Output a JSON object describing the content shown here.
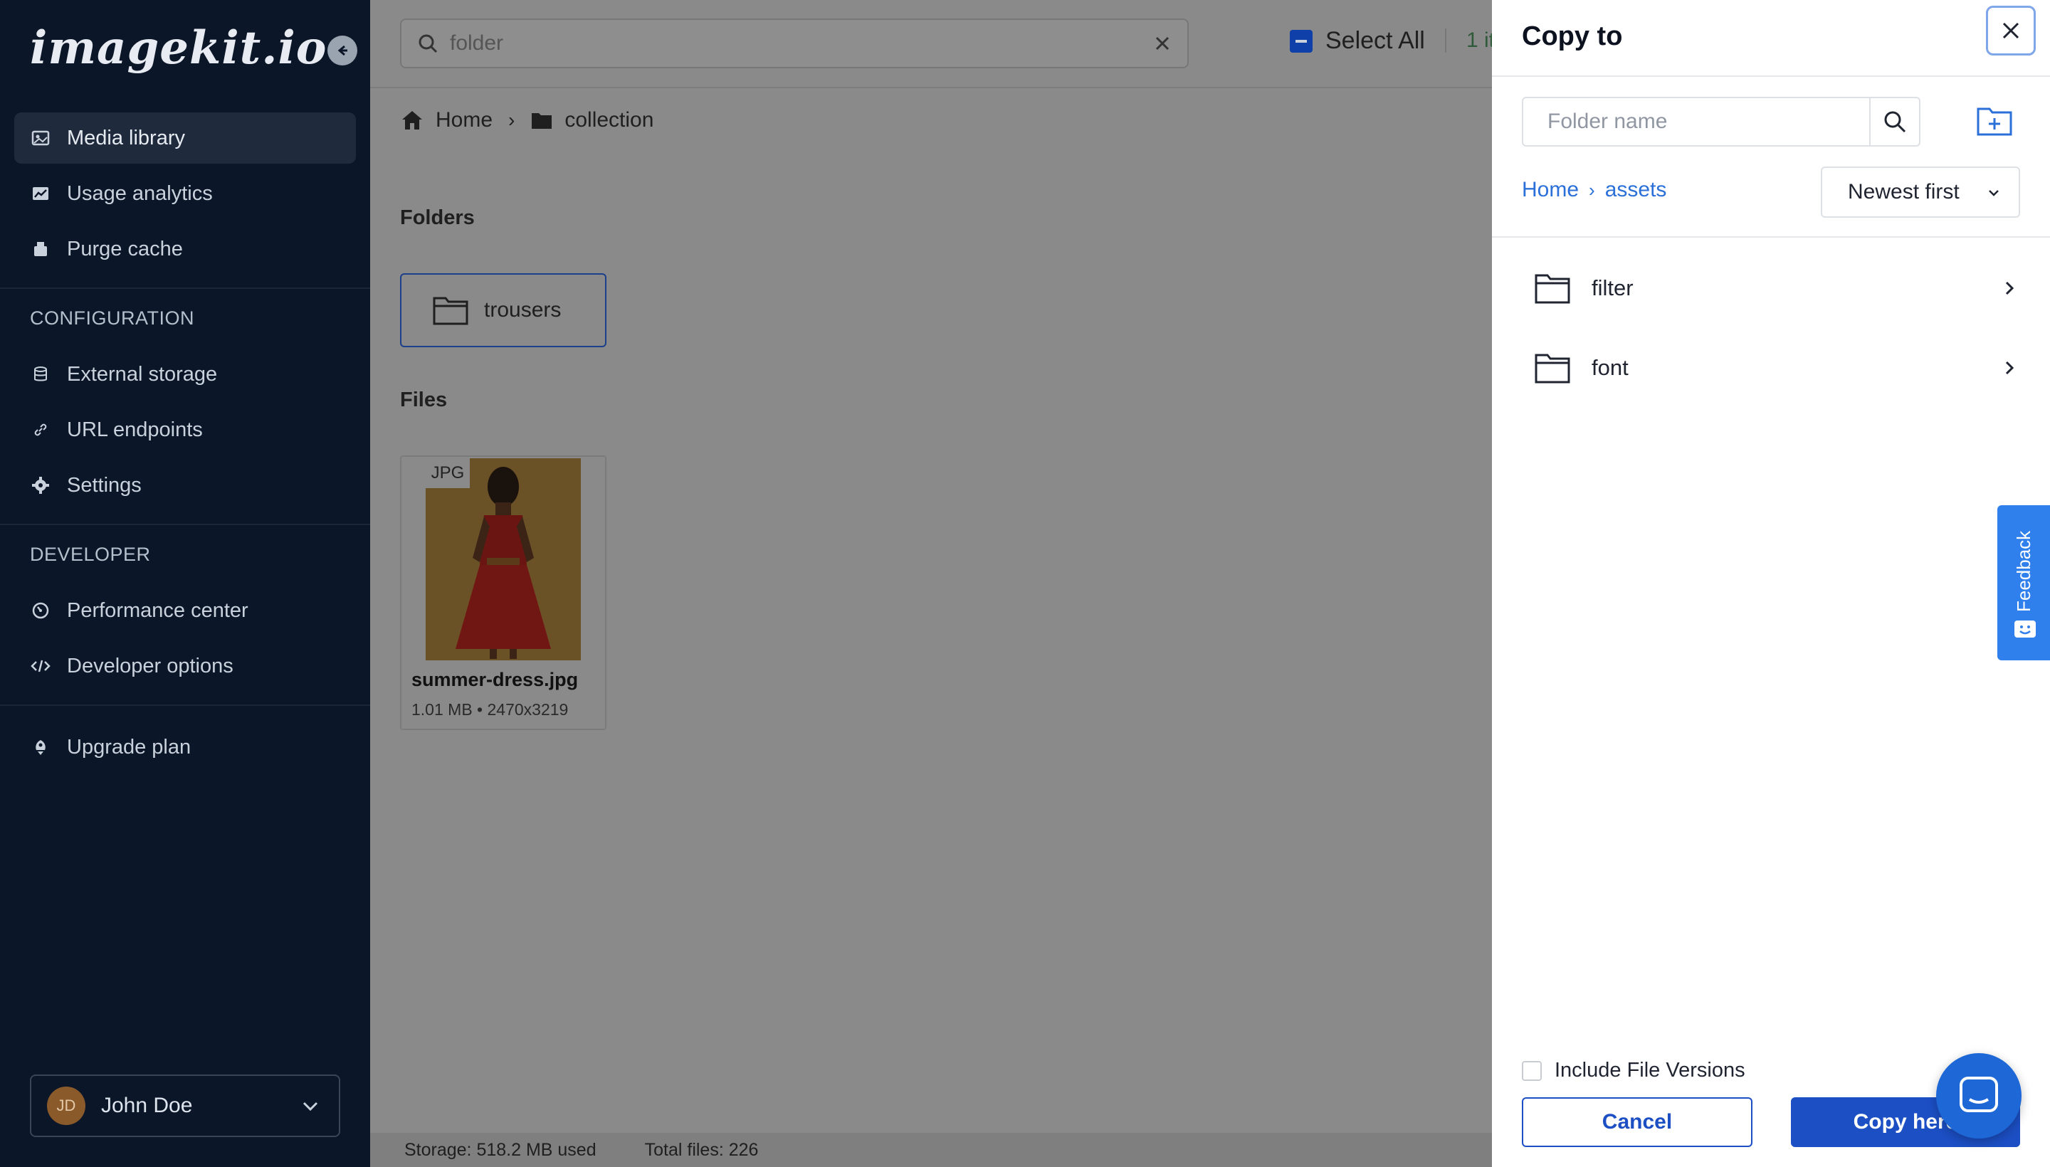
{
  "sidebar": {
    "logo": "imagekit.io",
    "items": [
      {
        "label": "Media library",
        "icon": "media-library-icon",
        "active": true
      },
      {
        "label": "Usage analytics",
        "icon": "analytics-icon"
      },
      {
        "label": "Purge cache",
        "icon": "purge-cache-icon"
      }
    ],
    "configuration_title": "CONFIGURATION",
    "config_items": [
      {
        "label": "External storage",
        "icon": "database-icon"
      },
      {
        "label": "URL endpoints",
        "icon": "link-icon"
      },
      {
        "label": "Settings",
        "icon": "gear-icon"
      }
    ],
    "developer_title": "DEVELOPER",
    "developer_items": [
      {
        "label": "Performance center",
        "icon": "performance-icon"
      },
      {
        "label": "Developer options",
        "icon": "code-icon"
      }
    ],
    "upgrade": {
      "label": "Upgrade plan",
      "icon": "rocket-icon"
    },
    "user": {
      "initials": "JD",
      "name": "John Doe"
    }
  },
  "main": {
    "search": {
      "value": "",
      "placeholder": "folder"
    },
    "select_all_label": "Select All",
    "selected_count": "1 it",
    "breadcrumb": [
      "Home",
      "collection"
    ],
    "folders_heading": "Folders",
    "folders": [
      {
        "name": "trousers"
      }
    ],
    "files_heading": "Files",
    "files": [
      {
        "type": "JPG",
        "name": "summer-dress.jpg",
        "meta": "1.01 MB • 2470x3219"
      }
    ],
    "status": {
      "storage": "Storage: 518.2 MB used",
      "total": "Total files: 226"
    }
  },
  "panel": {
    "title": "Copy to",
    "folder_search_placeholder": "Folder name",
    "breadcrumb": [
      "Home",
      "assets"
    ],
    "sort": "Newest first",
    "folders": [
      {
        "name": "filter"
      },
      {
        "name": "font"
      }
    ],
    "include_versions_label": "Include File Versions",
    "cancel_label": "Cancel",
    "copy_label": "Copy here",
    "feedback_label": "Feedback"
  },
  "colors": {
    "sidebar_bg": "#0b1628",
    "primary": "#1c4fc4",
    "link": "#2b6fd8",
    "overlay": "#8a8a8a"
  }
}
